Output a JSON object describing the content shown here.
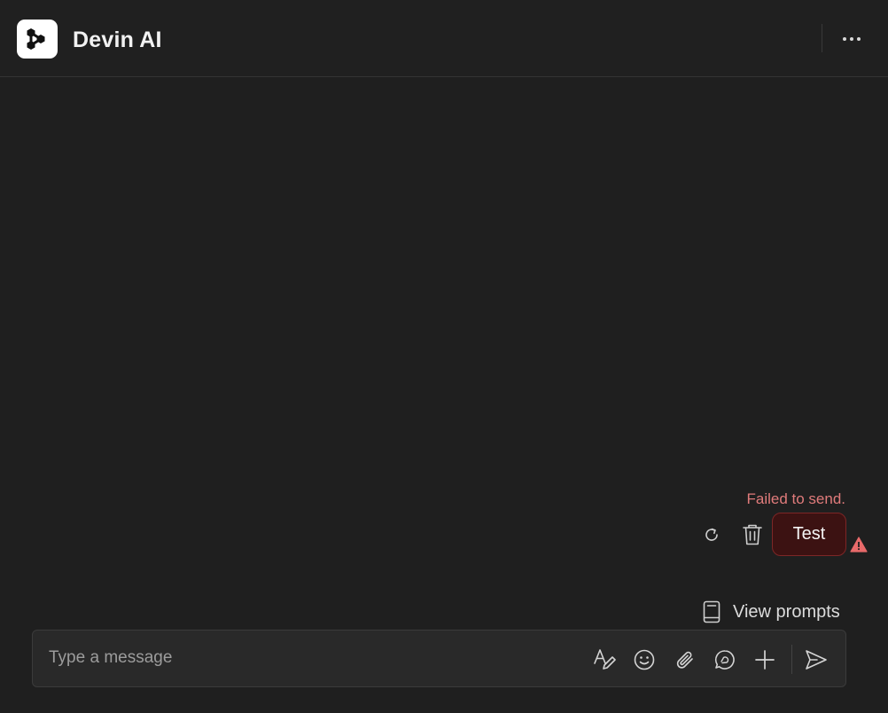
{
  "header": {
    "title": "Devin AI",
    "logo_icon": "devin-logo-icon",
    "more_icon": "more-horizontal-icon"
  },
  "conversation": {
    "messages": [
      {
        "role": "user",
        "text": "Test",
        "status": "failed",
        "error_text": "Failed to send."
      }
    ]
  },
  "message_actions": {
    "retry_icon": "refresh-icon",
    "delete_icon": "trash-icon",
    "warning_icon": "warning-triangle-icon"
  },
  "prompts": {
    "label": "View prompts",
    "icon": "book-icon"
  },
  "composer": {
    "placeholder": "Type a message",
    "value": "",
    "tools": [
      "text-format-icon",
      "emoji-icon",
      "attach-icon",
      "mention-icon",
      "plus-icon"
    ],
    "send_icon": "send-icon"
  },
  "colors": {
    "background": "#1f1f1f",
    "error_text": "#e07b7b",
    "failed_bubble_bg": "#3c1212",
    "failed_bubble_border": "#7d2626",
    "warning": "#e86a6a"
  }
}
